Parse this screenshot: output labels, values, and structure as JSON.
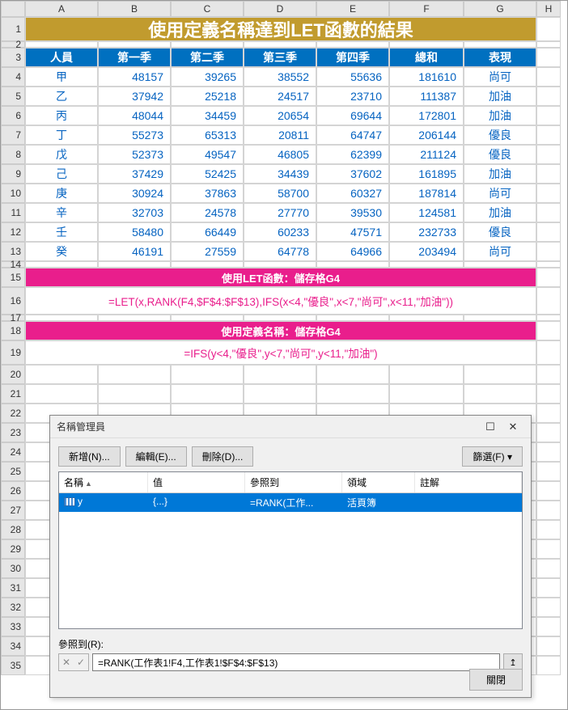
{
  "columns": [
    "A",
    "B",
    "C",
    "D",
    "E",
    "F",
    "G",
    "H"
  ],
  "rows": [
    "1",
    "2",
    "3",
    "4",
    "5",
    "6",
    "7",
    "8",
    "9",
    "10",
    "11",
    "12",
    "13",
    "14",
    "15",
    "16",
    "17",
    "18",
    "19",
    "20",
    "21",
    "22",
    "23",
    "24",
    "25",
    "26",
    "27",
    "28",
    "29",
    "30",
    "31",
    "32",
    "33",
    "34",
    "35"
  ],
  "title": "使用定義名稱達到LET函數的結果",
  "headers": [
    "人員",
    "第一季",
    "第二季",
    "第三季",
    "第四季",
    "總和",
    "表現"
  ],
  "data": [
    [
      "甲",
      "48157",
      "39265",
      "38552",
      "55636",
      "181610",
      "尚可"
    ],
    [
      "乙",
      "37942",
      "25218",
      "24517",
      "23710",
      "111387",
      "加油"
    ],
    [
      "丙",
      "48044",
      "34459",
      "20654",
      "69644",
      "172801",
      "加油"
    ],
    [
      "丁",
      "55273",
      "65313",
      "20811",
      "64747",
      "206144",
      "優良"
    ],
    [
      "戊",
      "52373",
      "49547",
      "46805",
      "62399",
      "211124",
      "優良"
    ],
    [
      "己",
      "37429",
      "52425",
      "34439",
      "37602",
      "161895",
      "加油"
    ],
    [
      "庚",
      "30924",
      "37863",
      "58700",
      "60327",
      "187814",
      "尚可"
    ],
    [
      "辛",
      "32703",
      "24578",
      "27770",
      "39530",
      "124581",
      "加油"
    ],
    [
      "壬",
      "58480",
      "66449",
      "60233",
      "47571",
      "232733",
      "優良"
    ],
    [
      "癸",
      "46191",
      "27559",
      "64778",
      "64966",
      "203494",
      "尚可"
    ]
  ],
  "section1_title": "使用LET函數：儲存格G4",
  "formula1": "=LET(x,RANK(F4,$F$4:$F$13),IFS(x<4,\"優良\",x<7,\"尚可\",x<11,\"加油\"))",
  "section2_title": "使用定義名稱：儲存格G4",
  "formula2": "=IFS(y<4,\"優良\",y<7,\"尚可\",y<11,\"加油\")",
  "dialog": {
    "title": "名稱管理員",
    "btn_new": "新增(N)...",
    "btn_edit": "編輯(E)...",
    "btn_delete": "刪除(D)...",
    "btn_filter": "篩選(F)",
    "cols": [
      "名稱",
      "值",
      "參照到",
      "領域",
      "註解"
    ],
    "row": {
      "name": "y",
      "value": "{...}",
      "refers": "=RANK(工作...",
      "scope": "活頁簿",
      "comment": ""
    },
    "ref_label": "參照到(R):",
    "ref_value": "=RANK(工作表1!F4,工作表1!$F$4:$F$13)",
    "btn_close": "關閉"
  }
}
